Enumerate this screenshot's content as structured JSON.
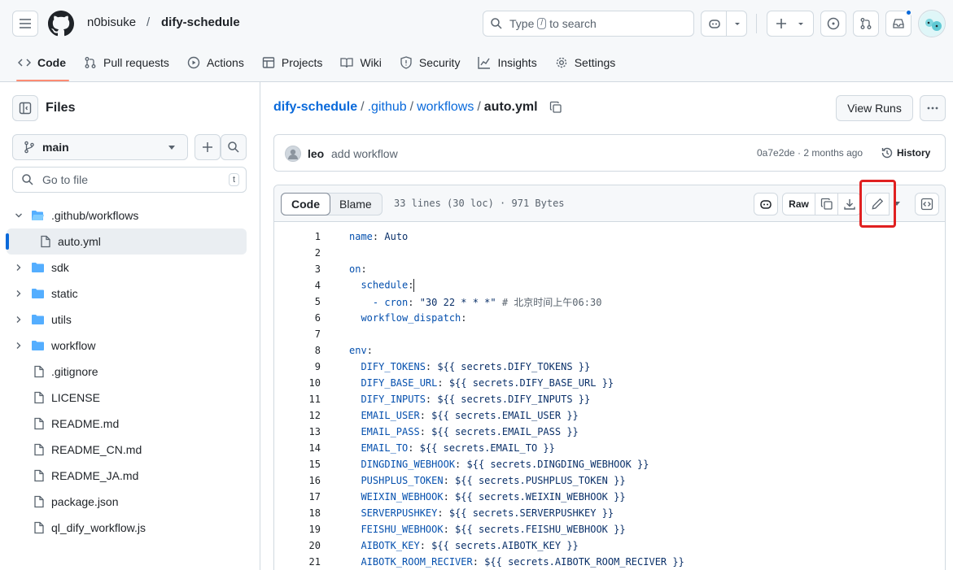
{
  "header": {
    "owner": "n0bisuke",
    "slash": "/",
    "repo": "dify-schedule",
    "search_prefix": "Type",
    "search_key": "/",
    "search_suffix": "to search",
    "plus": "+"
  },
  "tabs": [
    {
      "label": "Code",
      "icon": "code-icon"
    },
    {
      "label": "Pull requests",
      "icon": "git-pull-request-icon"
    },
    {
      "label": "Actions",
      "icon": "play-icon"
    },
    {
      "label": "Projects",
      "icon": "table-icon"
    },
    {
      "label": "Wiki",
      "icon": "book-icon"
    },
    {
      "label": "Security",
      "icon": "shield-icon"
    },
    {
      "label": "Insights",
      "icon": "graph-icon"
    },
    {
      "label": "Settings",
      "icon": "gear-icon"
    }
  ],
  "sidebar": {
    "title": "Files",
    "branch": "main",
    "goto_placeholder": "Go to file",
    "goto_shortcut": "t",
    "tree": [
      {
        "label": ".github/workflows",
        "type": "folder",
        "expanded": true
      },
      {
        "label": "auto.yml",
        "type": "file",
        "selected": true
      },
      {
        "label": "sdk",
        "type": "folder"
      },
      {
        "label": "static",
        "type": "folder"
      },
      {
        "label": "utils",
        "type": "folder"
      },
      {
        "label": "workflow",
        "type": "folder"
      },
      {
        "label": ".gitignore",
        "type": "file"
      },
      {
        "label": "LICENSE",
        "type": "file"
      },
      {
        "label": "README.md",
        "type": "file"
      },
      {
        "label": "README_CN.md",
        "type": "file"
      },
      {
        "label": "README_JA.md",
        "type": "file"
      },
      {
        "label": "package.json",
        "type": "file"
      },
      {
        "label": "ql_dify_workflow.js",
        "type": "file"
      }
    ]
  },
  "breadcrumb": {
    "repo": "dify-schedule",
    "dir1": ".github",
    "dir2": "workflows",
    "file": "auto.yml",
    "sep": "/"
  },
  "actions": {
    "view_runs": "View Runs"
  },
  "commit": {
    "author": "leo",
    "message": "add workflow",
    "hash_time": "0a7e2de · 2 months ago",
    "history": "History"
  },
  "codeview": {
    "tab_code": "Code",
    "tab_blame": "Blame",
    "file_info": "33 lines (30 loc) · 971 Bytes",
    "raw": "Raw"
  },
  "code_lines": [
    {
      "n": "1",
      "key": "name",
      "rest": " Auto"
    },
    {
      "n": "2",
      "key": "",
      "rest": ""
    },
    {
      "n": "3",
      "key": "on",
      "rest": ""
    },
    {
      "n": "4",
      "key": "  schedule",
      "rest": ""
    },
    {
      "n": "5",
      "key": "    - cron",
      "rest": " \"30 22 * * *\" # 北京时间上午06:30"
    },
    {
      "n": "6",
      "key": "  workflow_dispatch",
      "rest": ""
    },
    {
      "n": "7",
      "key": "",
      "rest": ""
    },
    {
      "n": "8",
      "key": "env",
      "rest": ""
    },
    {
      "n": "9",
      "key": "  DIFY_TOKENS",
      "rest": " ${{ secrets.DIFY_TOKENS }}"
    },
    {
      "n": "10",
      "key": "  DIFY_BASE_URL",
      "rest": " ${{ secrets.DIFY_BASE_URL }}"
    },
    {
      "n": "11",
      "key": "  DIFY_INPUTS",
      "rest": " ${{ secrets.DIFY_INPUTS }}"
    },
    {
      "n": "12",
      "key": "  EMAIL_USER",
      "rest": " ${{ secrets.EMAIL_USER }}"
    },
    {
      "n": "13",
      "key": "  EMAIL_PASS",
      "rest": " ${{ secrets.EMAIL_PASS }}"
    },
    {
      "n": "14",
      "key": "  EMAIL_TO",
      "rest": " ${{ secrets.EMAIL_TO }}"
    },
    {
      "n": "15",
      "key": "  DINGDING_WEBHOOK",
      "rest": " ${{ secrets.DINGDING_WEBHOOK }}"
    },
    {
      "n": "16",
      "key": "  PUSHPLUS_TOKEN",
      "rest": " ${{ secrets.PUSHPLUS_TOKEN }}"
    },
    {
      "n": "17",
      "key": "  WEIXIN_WEBHOOK",
      "rest": " ${{ secrets.WEIXIN_WEBHOOK }}"
    },
    {
      "n": "18",
      "key": "  SERVERPUSHKEY",
      "rest": " ${{ secrets.SERVERPUSHKEY }}"
    },
    {
      "n": "19",
      "key": "  FEISHU_WEBHOOK",
      "rest": " ${{ secrets.FEISHU_WEBHOOK }}"
    },
    {
      "n": "20",
      "key": "  AIBOTK_KEY",
      "rest": " ${{ secrets.AIBOTK_KEY }}"
    },
    {
      "n": "21",
      "key": "  AIBOTK_ROOM_RECIVER",
      "rest": " ${{ secrets.AIBOTK_ROOM_RECIVER }}"
    }
  ],
  "colors": {
    "accent_link": "#0969da",
    "tab_underline": "#fd8c73",
    "highlight_box": "#e02020"
  }
}
